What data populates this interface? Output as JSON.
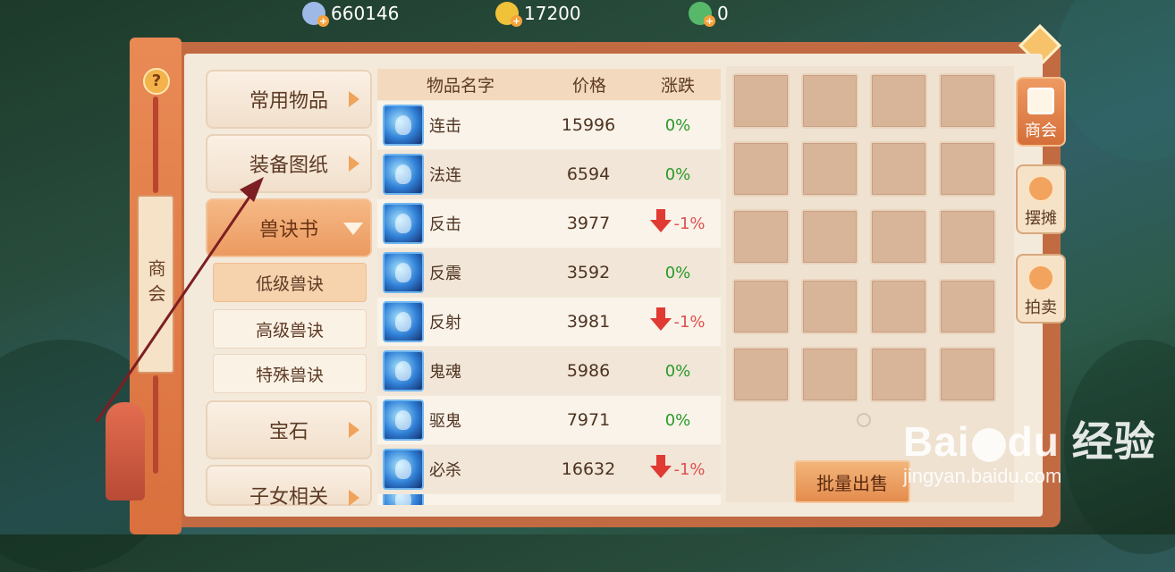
{
  "currency": [
    {
      "icon": "silver-coin-icon",
      "value": "660146",
      "color": "#9fb9e6"
    },
    {
      "icon": "gold-coin-icon",
      "value": "17200",
      "color": "#f0c23a"
    },
    {
      "icon": "jade-coin-icon",
      "value": "0",
      "color": "#58b86a"
    }
  ],
  "rail": {
    "help": "?",
    "label": "商会"
  },
  "categories": [
    {
      "label": "常用物品"
    },
    {
      "label": "装备图纸"
    },
    {
      "label": "兽诀书"
    },
    {
      "label": "宝石"
    },
    {
      "label": "子女相关"
    }
  ],
  "subcategories": [
    {
      "label": "低级兽诀"
    },
    {
      "label": "高级兽诀"
    },
    {
      "label": "特殊兽诀"
    }
  ],
  "table": {
    "headers": {
      "name": "物品名字",
      "price": "价格",
      "change": "涨跌"
    },
    "rows": [
      {
        "name": "连击",
        "price": "15996",
        "change": "0%",
        "trend": "flat"
      },
      {
        "name": "法连",
        "price": "6594",
        "change": "0%",
        "trend": "flat"
      },
      {
        "name": "反击",
        "price": "3977",
        "change": "-1%",
        "trend": "down"
      },
      {
        "name": "反震",
        "price": "3592",
        "change": "0%",
        "trend": "flat"
      },
      {
        "name": "反射",
        "price": "3981",
        "change": "-1%",
        "trend": "down"
      },
      {
        "name": "鬼魂",
        "price": "5986",
        "change": "0%",
        "trend": "flat"
      },
      {
        "name": "驱鬼",
        "price": "7971",
        "change": "0%",
        "trend": "flat"
      },
      {
        "name": "必杀",
        "price": "16632",
        "change": "-1%",
        "trend": "down"
      }
    ]
  },
  "sell_button": "批量出售",
  "side_tabs": [
    {
      "label": "商会",
      "icon": "guild-icon"
    },
    {
      "label": "摆摊",
      "icon": "stall-icon"
    },
    {
      "label": "拍卖",
      "icon": "auction-icon"
    }
  ],
  "watermark": {
    "logo_a": "Bai",
    "logo_b": "du",
    "logo_c": "经验",
    "url": "jingyan.baidu.com"
  }
}
